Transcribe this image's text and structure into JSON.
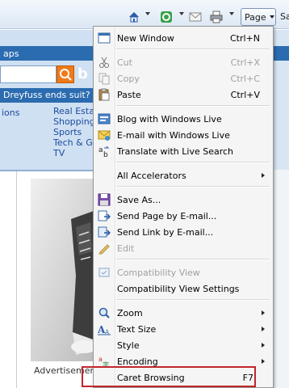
{
  "toolbar": {
    "page_label": "Page",
    "safety_label": "Sa",
    "icons": [
      "home-icon",
      "feeds-icon",
      "read-mail-icon",
      "print-icon"
    ]
  },
  "webpage": {
    "maps_tab": "aps",
    "headline": "Dreyfuss ends suit?",
    "left_link": "ions",
    "links": [
      "Real Esta",
      "Shopping",
      "Sports",
      "Tech & G",
      "TV"
    ],
    "ad_label": "Advertisement"
  },
  "menu": {
    "items": [
      {
        "label": "New Window",
        "shortcut": "Ctrl+N",
        "icon": "new-window-icon",
        "enabled": true
      },
      {
        "label": "Cut",
        "shortcut": "Ctrl+X",
        "icon": "cut-icon",
        "enabled": false
      },
      {
        "label": "Copy",
        "shortcut": "Ctrl+C",
        "icon": "copy-icon",
        "enabled": false
      },
      {
        "label": "Paste",
        "shortcut": "Ctrl+V",
        "icon": "paste-icon",
        "enabled": true
      },
      {
        "label": "Blog with Windows Live",
        "icon": "blog-icon",
        "enabled": true
      },
      {
        "label": "E-mail with Windows Live",
        "icon": "email-live-icon",
        "enabled": true
      },
      {
        "label": "Translate with Live Search",
        "icon": "translate-icon",
        "enabled": true
      },
      {
        "label": "All Accelerators",
        "submenu": true,
        "enabled": true
      },
      {
        "label": "Save As...",
        "icon": "save-as-icon",
        "enabled": true
      },
      {
        "label": "Send Page by E-mail...",
        "icon": "send-page-icon",
        "enabled": true
      },
      {
        "label": "Send Link by E-mail...",
        "icon": "send-link-icon",
        "enabled": true
      },
      {
        "label": "Edit",
        "icon": "edit-icon",
        "enabled": false
      },
      {
        "label": "Compatibility View",
        "icon": "compatibility-view-icon",
        "enabled": false
      },
      {
        "label": "Compatibility View Settings",
        "enabled": true
      },
      {
        "label": "Zoom",
        "icon": "zoom-icon",
        "submenu": true,
        "enabled": true
      },
      {
        "label": "Text Size",
        "icon": "text-size-icon",
        "submenu": true,
        "enabled": true
      },
      {
        "label": "Style",
        "submenu": true,
        "enabled": true
      },
      {
        "label": "Encoding",
        "icon": "encoding-icon",
        "submenu": true,
        "enabled": true
      },
      {
        "label": "Caret Browsing",
        "shortcut": "F7",
        "enabled": true
      }
    ]
  },
  "colors": {
    "highlight_border": "#c0262b",
    "menu_background": "#f5f5f5"
  }
}
